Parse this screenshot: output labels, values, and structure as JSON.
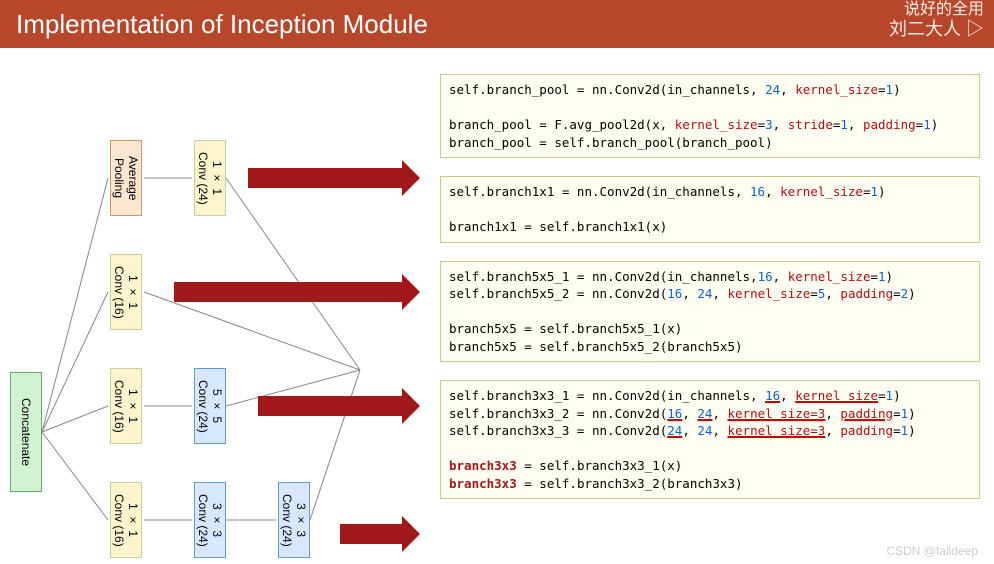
{
  "header": {
    "title": "Implementation of Inception Module"
  },
  "watermark": {
    "line1": "说好的全用",
    "line2": "刘二大人 ▷"
  },
  "diagram": {
    "concat": "Concatenate",
    "avgpool": "Average Pooling",
    "conv1_24": "1 × 1 Conv (24)",
    "conv1_16a": "1 × 1 Conv (16)",
    "conv1_16b": "1 × 1 Conv (16)",
    "conv1_16c": "1 × 1 Conv (16)",
    "conv5_24": "5 × 5 Conv (24)",
    "conv3_24a": "3 × 3 Conv (24)",
    "conv3_24b": "3 × 3 Conv (24)"
  },
  "code": {
    "box1": {
      "l1_pre": "self.branch_pool = nn.Conv2d(in_channels, ",
      "l1_n": "24",
      "l1_mid": ", ",
      "l1_a": "kernel_size",
      "l1_eq": "=",
      "l1_v": "1",
      "l1_end": ")",
      "l2_pre": "branch_pool = F.avg_pool2d(x, ",
      "l2_a1": "kernel_size",
      "l2_v1": "3",
      "l2_a2": "stride",
      "l2_v2": "1",
      "l2_a3": "padding",
      "l2_v3": "1",
      "l2_end": ")",
      "l3": "branch_pool = self.branch_pool(branch_pool)"
    },
    "box2": {
      "l1_pre": "self.branch1x1 = nn.Conv2d(in_channels, ",
      "l1_n": "16",
      "l1_a": "kernel_size",
      "l1_v": "1",
      "l2": "branch1x1 = self.branch1x1(x)"
    },
    "box3": {
      "l1_pre": "self.branch5x5_1 = nn.Conv2d(in_channels,",
      "l1_n": "16",
      "l1_a": "kernel_size",
      "l1_v": "1",
      "l2_pre": "self.branch5x5_2 = nn.Conv2d(",
      "l2_n1": "16",
      "l2_n2": "24",
      "l2_a1": "kernel_size",
      "l2_v1": "5",
      "l2_a2": "padding",
      "l2_v2": "2",
      "l3": "branch5x5 = self.branch5x5_1(x)",
      "l4": "branch5x5 = self.branch5x5_2(branch5x5)"
    },
    "box4": {
      "l1_pre": "self.branch3x3_1 = nn.Conv2d(in_channels, ",
      "l1_n": "16",
      "l1_a": "kernel_size",
      "l1_v": "1",
      "l2_pre": "self.branch3x3_2 = nn.Conv2d(",
      "l2_n1": "16",
      "l2_n2": "24",
      "l2_a1": "kernel_size=3",
      "l2_a2": "padding",
      "l2_v2": "1",
      "l3_pre": "self.branch3x3_3 = nn.Conv2d(",
      "l3_n1": "24",
      "l3_n2": "24",
      "l3_a1": "kernel_size=3",
      "l3_a2": "padding",
      "l3_v2": "1",
      "l4_b": "branch3x3",
      "l4_rest": " = self.branch3x3_1(x)",
      "l5_b": "branch3x3",
      "l5_rest": " = self.branch3x3_2(branch3x3)"
    }
  },
  "footer": {
    "csdn": "CSDN @falldeep"
  }
}
